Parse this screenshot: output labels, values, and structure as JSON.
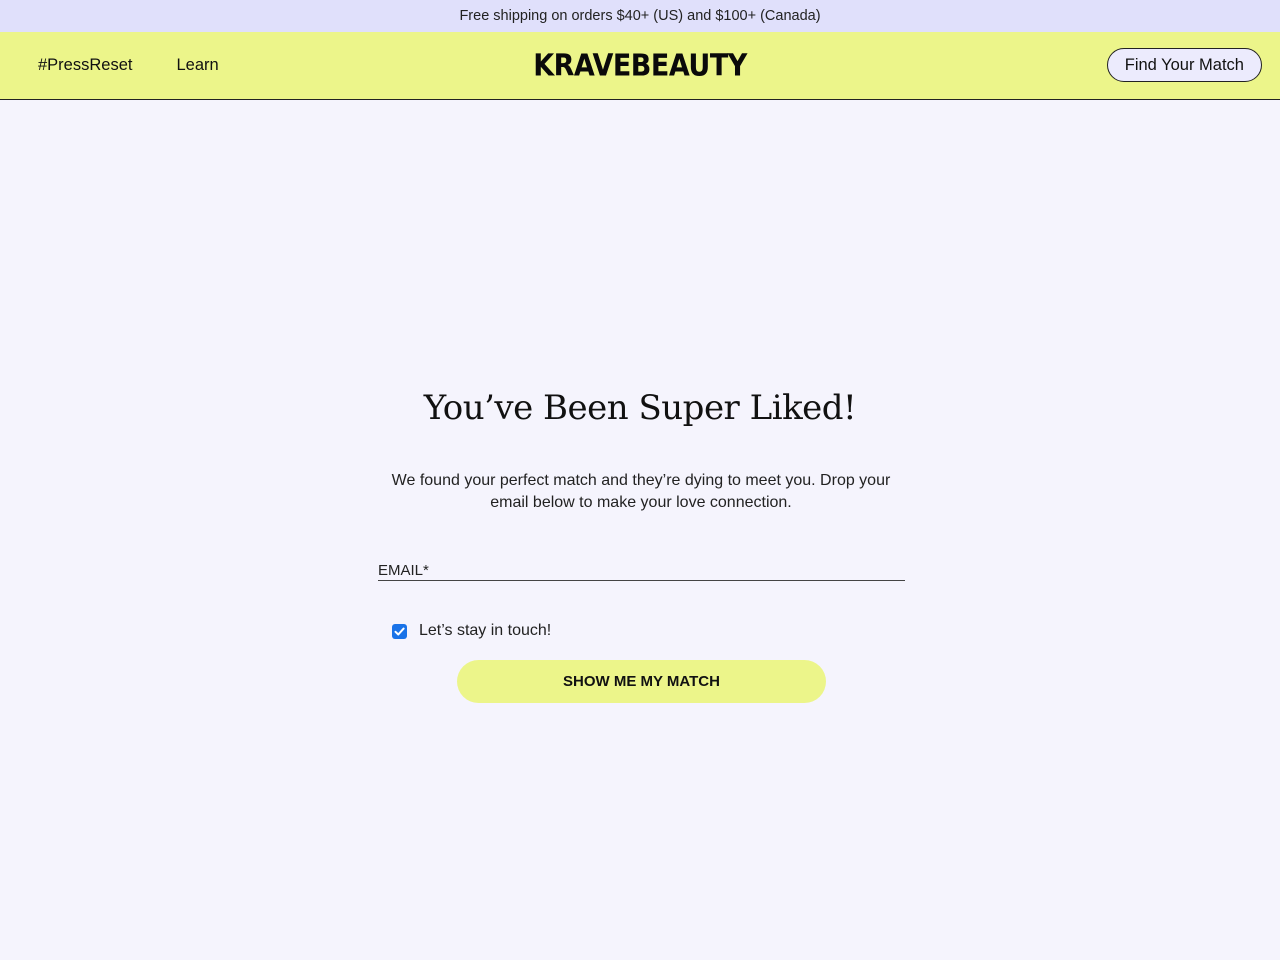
{
  "announcement": {
    "text": "Free shipping on orders $40+ (US) and $100+ (Canada)"
  },
  "header": {
    "nav": [
      {
        "label": "#PressReset"
      },
      {
        "label": "Learn"
      }
    ],
    "logo": "KRAVEBEAUTY",
    "cta_label": "Find Your Match"
  },
  "main": {
    "heading": "You’ve Been Super Liked!",
    "subtext": "We found your perfect match and they’re dying to meet you. Drop your email below to make your love connection.",
    "email": {
      "placeholder": "EMAIL*",
      "value": ""
    },
    "checkbox": {
      "label": "Let’s stay in touch!",
      "checked": true
    },
    "submit_label": "SHOW ME MY MATCH"
  },
  "colors": {
    "accent_yellow": "#ecf58a",
    "announcement_bg": "#e0e0fb",
    "page_bg": "#f5f4fd",
    "checkbox_blue": "#1a73e8"
  }
}
